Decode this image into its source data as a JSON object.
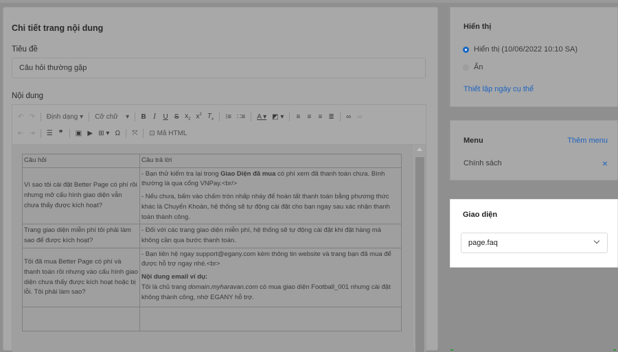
{
  "main": {
    "title": "Chi tiết trang nội dung",
    "title_label": "Tiêu đề",
    "title_value": "Câu hỏi thường gặp",
    "content_label": "Nội dung",
    "toolbar": {
      "format_label": "Định dạng",
      "fontsize_label": "Cỡ chữ",
      "html_label": "Mã HTML"
    },
    "table": {
      "headers": [
        "Câu hỏi",
        "Câu trả lời"
      ],
      "rows": [
        {
          "q": "Vì sao tôi cài đặt Better Page có phí rồi nhưng mở cấu hình giao diện vẫn chưa thấy được kích hoạt?",
          "a1_pre": "- Bạn thử kiểm tra lại trong ",
          "a1_bold": "Giao Diện đã mua",
          "a1_post": " có phí xem đã thanh toán chưa. Bình thường là qua cổng VNPay.<br/>",
          "a2": "- Nếu chưa, bấm vào chấm tròn nhấp nháy để hoàn tất thanh toán bằng phương thức khác là Chuyển Khoản, hệ thống sẽ tự động cài đặt cho bạn ngay sau xác nhận thanh toán thành công."
        },
        {
          "q": "Trang giao diện miễn phí tôi phải làm sao để được kích hoạt?",
          "a1": "- Đối với các trang giao diện miễn phí, hệ thống sẽ tự động cài đặt khi đặt hàng mà không cần qua bước thanh toán."
        },
        {
          "q": "Tôi đã mua Better Page có phí và thanh toán rồi nhưng vào cấu hình giao diện chưa thấy được kích hoạt hoặc bị lỗi. Tôi phải làm sao?",
          "a1": "- Bạn liên hệ ngay support@egany.com kèm thông tin website và trang bạn đã mua để được hỗ trợ ngay nhé.<br>",
          "a2_bold": "Nội dung email ví dụ:",
          "a3_pre": "Tôi là chủ trang ",
          "a3_em": "domain.myharavan.com",
          "a3_post": " có mua giao diện Football_001 nhưng cài đặt không thành công, nhờ EGANY hỗ trợ."
        }
      ]
    }
  },
  "visibility": {
    "title": "Hiển thị",
    "options": [
      "Hiển thị (10/06/2022 10:10 SA)",
      "Ẩn"
    ],
    "selected_index": 0,
    "set_date_link": "Thiết lập ngày cụ thể"
  },
  "menu": {
    "title": "Menu",
    "add_link": "Thêm menu",
    "item": "Chính sách"
  },
  "theme": {
    "title": "Giao diện",
    "selected": "page.faq"
  },
  "colors": {
    "accent": "#1e63c0",
    "overlay": "#8f8f8f"
  }
}
